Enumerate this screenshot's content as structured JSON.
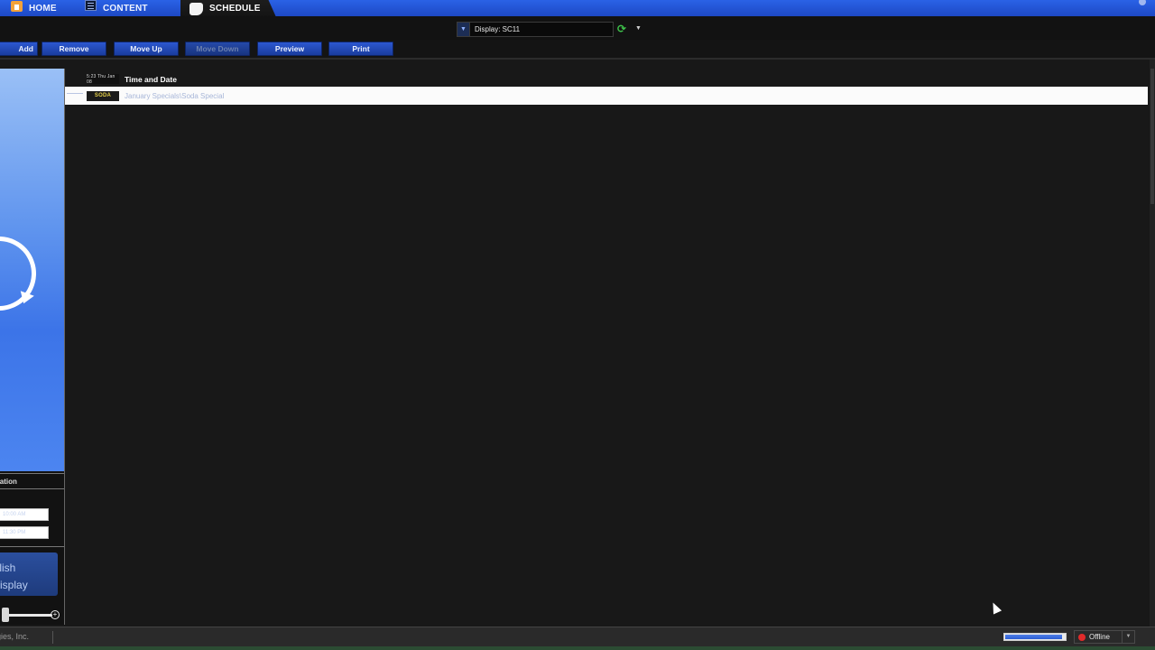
{
  "tabs": [
    {
      "label": "HOME"
    },
    {
      "label": "CONTENT"
    },
    {
      "label": "SCHEDULE"
    }
  ],
  "display_selector": {
    "value": "Display: SC11"
  },
  "toolbar": {
    "add": "Add",
    "remove": "Remove",
    "move_up": "Move Up",
    "move_down": "Move Down",
    "preview": "Preview",
    "print": "Print"
  },
  "left_panel": {
    "duration_header": "Duration",
    "start_time": "10:00 AM",
    "end_time": "11:30 PM",
    "publish_line1": "Publish",
    "publish_line2": "to Display"
  },
  "schedule_items": [
    {
      "thumb_text": "5:23 Thu Jan 08",
      "label": "Time and Date"
    },
    {
      "thumb_text": "SODA",
      "label": "January Specials\\Soda Special"
    }
  ],
  "status": {
    "copyright": "Technologies, Inc.",
    "progress": 0.95,
    "connection": "Offline",
    "connection_color": "#e12a2a"
  },
  "colors": {
    "tab_bar": "#2a62e6",
    "button": "#2c58d0",
    "panel_preview": "#5f94ee"
  }
}
